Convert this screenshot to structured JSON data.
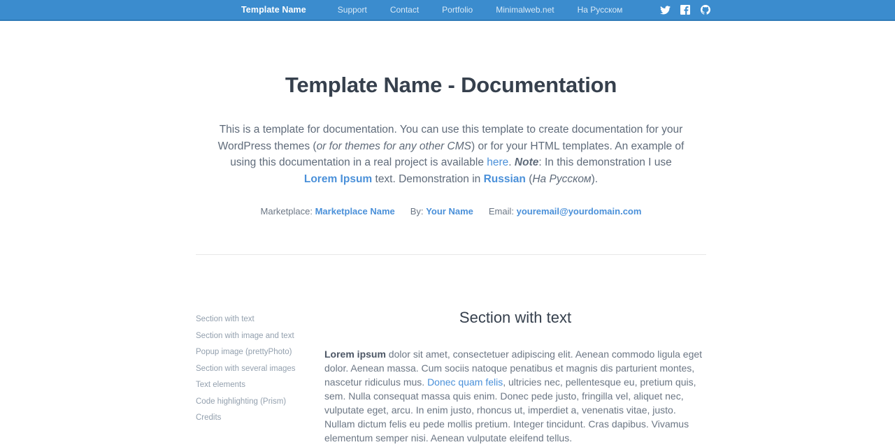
{
  "navbar": {
    "brand": "Template Name",
    "links": [
      {
        "label": "Support"
      },
      {
        "label": "Contact"
      },
      {
        "label": "Portfolio"
      },
      {
        "label": "Minimalweb.net"
      },
      {
        "label": "На Русском"
      }
    ],
    "social": [
      {
        "name": "twitter-icon"
      },
      {
        "name": "facebook-icon"
      },
      {
        "name": "github-icon"
      }
    ],
    "background_color": "#3b8cce"
  },
  "intro": {
    "title": "Template Name - Documentation",
    "p1_a": "This is a template for documentation. You can use this template to create documentation for your WordPress themes (",
    "p1_em": "or for themes for any other CMS",
    "p1_b": ") or for your HTML templates. An example of using this documentation in a real project is available ",
    "link_here": "here",
    "p1_c": ". ",
    "note_label": "Note",
    "p1_d": ": In this demonstration I use ",
    "link_lorem": "Lorem Ipsum",
    "p1_e": " text. Demonstration in ",
    "link_russian": "Russian",
    "p1_f": " (",
    "russian_em": "На Русском",
    "p1_g": ").",
    "marketplace_label": "Marketplace:",
    "marketplace_value": "Marketplace Name",
    "by_label": "By:",
    "by_value": "Your Name",
    "email_label": "Email:",
    "email_value": "youremail@yourdomain.com"
  },
  "sidebar": {
    "items": [
      {
        "label": "Section with text"
      },
      {
        "label": "Section with image and text"
      },
      {
        "label": "Popup image (prettyPhoto)"
      },
      {
        "label": "Section with several images"
      },
      {
        "label": "Text elements"
      },
      {
        "label": "Code highlighting (Prism)"
      },
      {
        "label": "Credits"
      }
    ]
  },
  "main": {
    "section_title": "Section with text",
    "para_bold": "Lorem ipsum",
    "para_a": " dolor sit amet, consectetuer adipiscing elit. Aenean commodo ligula eget dolor. Aenean massa. Cum sociis natoque penatibus et magnis dis parturient montes, nascetur ridiculus mus. ",
    "link_donec": "Donec quam felis",
    "para_b": ", ultricies nec, pellentesque eu, pretium quis, sem. Nulla consequat massa quis enim. Donec pede justo, fringilla vel, aliquet nec, vulputate eget, arcu. In enim justo, rhoncus ut, imperdiet a, venenatis vitae, justo. Nullam dictum felis eu pede mollis pretium. Integer tincidunt. Cras dapibus. Vivamus elementum semper nisi. Aenean vulputate eleifend tellus."
  },
  "colors": {
    "accent": "#4a90d9",
    "navbar": "#3b8cce",
    "heading": "#36404d",
    "body": "#6b7684"
  }
}
